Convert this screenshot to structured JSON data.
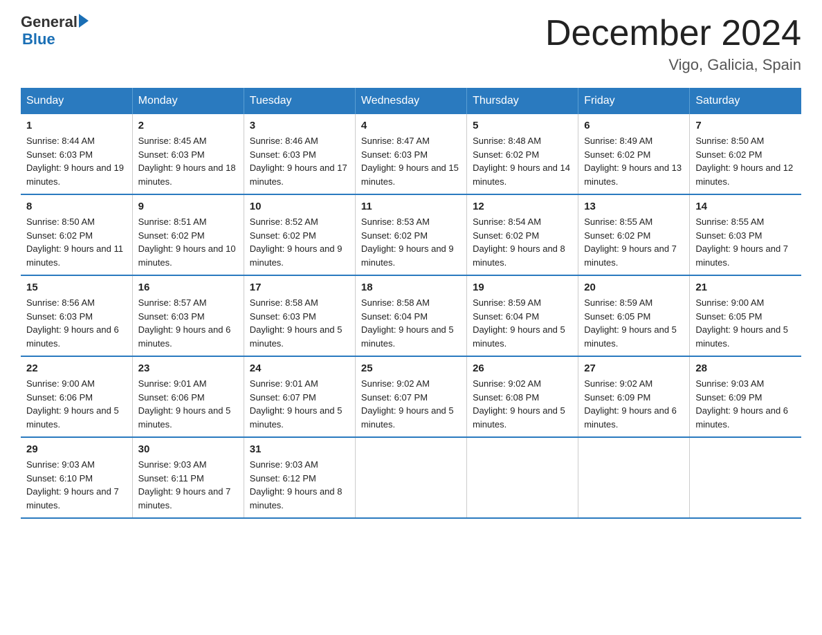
{
  "header": {
    "logo_line1": "General",
    "logo_line2": "Blue",
    "month_title": "December 2024",
    "location": "Vigo, Galicia, Spain"
  },
  "days_of_week": [
    "Sunday",
    "Monday",
    "Tuesday",
    "Wednesday",
    "Thursday",
    "Friday",
    "Saturday"
  ],
  "weeks": [
    [
      {
        "day": "1",
        "sunrise": "8:44 AM",
        "sunset": "6:03 PM",
        "daylight": "9 hours and 19 minutes."
      },
      {
        "day": "2",
        "sunrise": "8:45 AM",
        "sunset": "6:03 PM",
        "daylight": "9 hours and 18 minutes."
      },
      {
        "day": "3",
        "sunrise": "8:46 AM",
        "sunset": "6:03 PM",
        "daylight": "9 hours and 17 minutes."
      },
      {
        "day": "4",
        "sunrise": "8:47 AM",
        "sunset": "6:03 PM",
        "daylight": "9 hours and 15 minutes."
      },
      {
        "day": "5",
        "sunrise": "8:48 AM",
        "sunset": "6:02 PM",
        "daylight": "9 hours and 14 minutes."
      },
      {
        "day": "6",
        "sunrise": "8:49 AM",
        "sunset": "6:02 PM",
        "daylight": "9 hours and 13 minutes."
      },
      {
        "day": "7",
        "sunrise": "8:50 AM",
        "sunset": "6:02 PM",
        "daylight": "9 hours and 12 minutes."
      }
    ],
    [
      {
        "day": "8",
        "sunrise": "8:50 AM",
        "sunset": "6:02 PM",
        "daylight": "9 hours and 11 minutes."
      },
      {
        "day": "9",
        "sunrise": "8:51 AM",
        "sunset": "6:02 PM",
        "daylight": "9 hours and 10 minutes."
      },
      {
        "day": "10",
        "sunrise": "8:52 AM",
        "sunset": "6:02 PM",
        "daylight": "9 hours and 9 minutes."
      },
      {
        "day": "11",
        "sunrise": "8:53 AM",
        "sunset": "6:02 PM",
        "daylight": "9 hours and 9 minutes."
      },
      {
        "day": "12",
        "sunrise": "8:54 AM",
        "sunset": "6:02 PM",
        "daylight": "9 hours and 8 minutes."
      },
      {
        "day": "13",
        "sunrise": "8:55 AM",
        "sunset": "6:02 PM",
        "daylight": "9 hours and 7 minutes."
      },
      {
        "day": "14",
        "sunrise": "8:55 AM",
        "sunset": "6:03 PM",
        "daylight": "9 hours and 7 minutes."
      }
    ],
    [
      {
        "day": "15",
        "sunrise": "8:56 AM",
        "sunset": "6:03 PM",
        "daylight": "9 hours and 6 minutes."
      },
      {
        "day": "16",
        "sunrise": "8:57 AM",
        "sunset": "6:03 PM",
        "daylight": "9 hours and 6 minutes."
      },
      {
        "day": "17",
        "sunrise": "8:58 AM",
        "sunset": "6:03 PM",
        "daylight": "9 hours and 5 minutes."
      },
      {
        "day": "18",
        "sunrise": "8:58 AM",
        "sunset": "6:04 PM",
        "daylight": "9 hours and 5 minutes."
      },
      {
        "day": "19",
        "sunrise": "8:59 AM",
        "sunset": "6:04 PM",
        "daylight": "9 hours and 5 minutes."
      },
      {
        "day": "20",
        "sunrise": "8:59 AM",
        "sunset": "6:05 PM",
        "daylight": "9 hours and 5 minutes."
      },
      {
        "day": "21",
        "sunrise": "9:00 AM",
        "sunset": "6:05 PM",
        "daylight": "9 hours and 5 minutes."
      }
    ],
    [
      {
        "day": "22",
        "sunrise": "9:00 AM",
        "sunset": "6:06 PM",
        "daylight": "9 hours and 5 minutes."
      },
      {
        "day": "23",
        "sunrise": "9:01 AM",
        "sunset": "6:06 PM",
        "daylight": "9 hours and 5 minutes."
      },
      {
        "day": "24",
        "sunrise": "9:01 AM",
        "sunset": "6:07 PM",
        "daylight": "9 hours and 5 minutes."
      },
      {
        "day": "25",
        "sunrise": "9:02 AM",
        "sunset": "6:07 PM",
        "daylight": "9 hours and 5 minutes."
      },
      {
        "day": "26",
        "sunrise": "9:02 AM",
        "sunset": "6:08 PM",
        "daylight": "9 hours and 5 minutes."
      },
      {
        "day": "27",
        "sunrise": "9:02 AM",
        "sunset": "6:09 PM",
        "daylight": "9 hours and 6 minutes."
      },
      {
        "day": "28",
        "sunrise": "9:03 AM",
        "sunset": "6:09 PM",
        "daylight": "9 hours and 6 minutes."
      }
    ],
    [
      {
        "day": "29",
        "sunrise": "9:03 AM",
        "sunset": "6:10 PM",
        "daylight": "9 hours and 7 minutes."
      },
      {
        "day": "30",
        "sunrise": "9:03 AM",
        "sunset": "6:11 PM",
        "daylight": "9 hours and 7 minutes."
      },
      {
        "day": "31",
        "sunrise": "9:03 AM",
        "sunset": "6:12 PM",
        "daylight": "9 hours and 8 minutes."
      },
      null,
      null,
      null,
      null
    ]
  ]
}
